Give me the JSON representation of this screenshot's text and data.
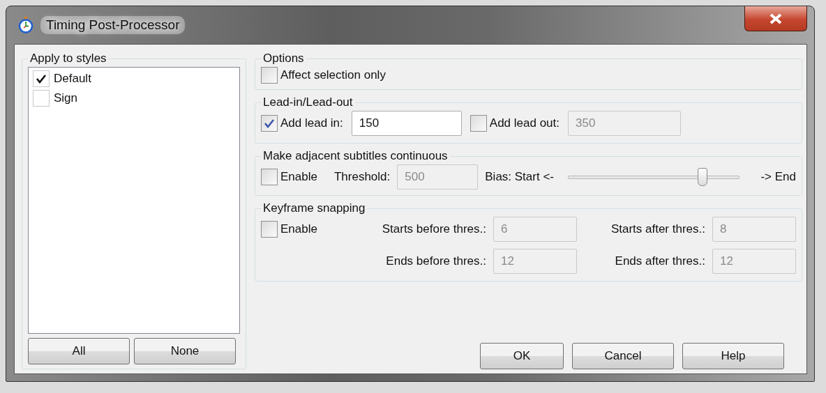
{
  "window": {
    "title": "Timing Post-Processor"
  },
  "styles": {
    "title": "Apply to styles",
    "items": [
      {
        "label": "Default",
        "checked": true
      },
      {
        "label": "Sign",
        "checked": false
      }
    ],
    "buttons": [
      "All",
      "None"
    ]
  },
  "options": {
    "title": "Options",
    "affect_selection": {
      "label": "Affect selection only",
      "checked": false
    }
  },
  "lead": {
    "title": "Lead-in/Lead-out",
    "lead_in": {
      "label": "Add lead in:",
      "checked": true,
      "value": "150"
    },
    "lead_out": {
      "label": "Add lead out:",
      "checked": false,
      "value": "350"
    }
  },
  "adjacent": {
    "title": "Make adjacent subtitles continuous",
    "enable": {
      "label": "Enable",
      "checked": false
    },
    "threshold": {
      "label": "Threshold:",
      "value": "500"
    },
    "bias": {
      "start_label": "Bias: Start <-",
      "end_label": "-> End",
      "level": 0.78
    }
  },
  "keyframe": {
    "title": "Keyframe snapping",
    "enable": {
      "label": "Enable",
      "checked": false
    },
    "fields": [
      {
        "label": "Starts before thres.:",
        "value": "6"
      },
      {
        "label": "Starts after thres.:",
        "value": "8"
      },
      {
        "label": "Ends before thres.:",
        "value": "12"
      },
      {
        "label": "Ends after thres.:",
        "value": "12"
      }
    ]
  },
  "buttons": [
    "OK",
    "Cancel",
    "Help"
  ]
}
